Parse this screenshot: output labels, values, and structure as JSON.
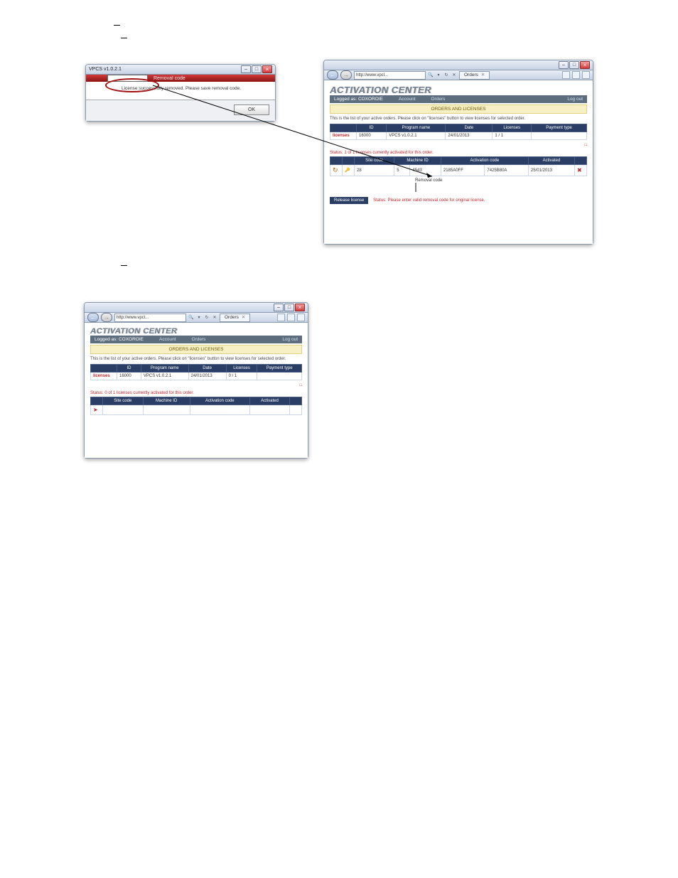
{
  "dialog": {
    "title": "VPCS v1.0.2.1",
    "removal_label": "Removal code",
    "message": "License successfully removed. Please save removal code.",
    "ok": "OK"
  },
  "browser1": {
    "addr": "http://www.vpcl...",
    "tab": "Orders",
    "ac_title": "ACTIVATION CENTER",
    "logged": "Logged as: COXOROIE",
    "nav_account": "Account",
    "nav_orders": "Orders",
    "nav_logout": "Log out",
    "gold": "ORDERS AND LICENSES",
    "hint": "This is the list of your active orders. Please click on \"licenses\" button to view licenses for selected order.",
    "orders": {
      "headers": {
        "id": "ID",
        "prog": "Program name",
        "date": "Date",
        "lic": "Licenses",
        "pay": "Payment type"
      },
      "row": {
        "link": "licenses",
        "id": "16000",
        "prog": "VPCS v1.0.2.1",
        "date": "24/01/2013",
        "lic": "1 / 1",
        "pay": ""
      }
    },
    "status": "Status: 1 of 1 licenses currently activated for this order.",
    "lic": {
      "headers": {
        "site": "Site code",
        "mid": "Machine ID",
        "ac": "Activation code",
        "act": "Activated"
      },
      "row": {
        "site": "28",
        "mid1": "5",
        "mid2": "4543",
        "ac1": "2185A0FF",
        "ac2": "7425B80A",
        "act": "25/01/2013"
      }
    },
    "rc_label": "Removal code",
    "action_btn": "Release license",
    "action_status": "Status: Please enter valid removal code for original license."
  },
  "browser2": {
    "addr": "http://www.vpcl...",
    "tab": "Orders",
    "ac_title": "ACTIVATION CENTER",
    "logged": "Logged as: COXOROIE",
    "nav_account": "Account",
    "nav_orders": "Orders",
    "nav_logout": "Log out",
    "gold": "ORDERS AND LICENSES",
    "hint": "This is the list of your active orders. Please click on \"licenses\" button to view licenses for selected order.",
    "orders": {
      "headers": {
        "id": "ID",
        "prog": "Program name",
        "date": "Date",
        "lic": "Licenses",
        "pay": "Payment type"
      },
      "row": {
        "link": "licenses",
        "id": "16000",
        "prog": "VPCS v1.0.2.1",
        "date": "24/01/2013",
        "lic": "0 / 1",
        "pay": ""
      }
    },
    "status": "Status: 0 of 1 licenses currently activated for this order.",
    "lic": {
      "headers": {
        "site": "Site code",
        "mid": "Machine ID",
        "ac": "Activation code",
        "act": "Activated"
      }
    }
  }
}
